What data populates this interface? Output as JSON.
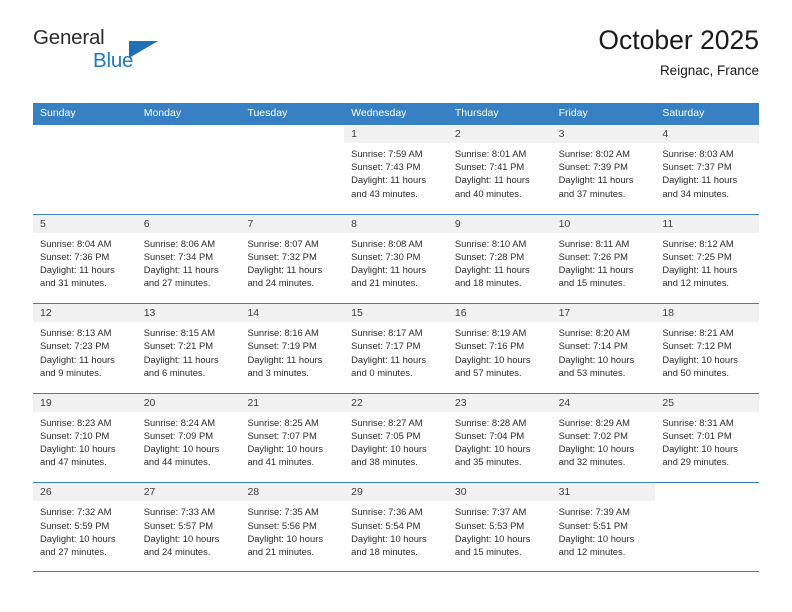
{
  "brand": {
    "name_top": "General",
    "name_bottom": "Blue",
    "color_dark": "#2b2b2b",
    "color_blue": "#2077c4"
  },
  "header": {
    "title": "October 2025",
    "subtitle": "Reignac, France"
  },
  "theme": {
    "header_blue": "#3880c4",
    "daynum_band": "#f1f1f1",
    "text": "#2b2b2b"
  },
  "weekday_headers": [
    "Sunday",
    "Monday",
    "Tuesday",
    "Wednesday",
    "Thursday",
    "Friday",
    "Saturday"
  ],
  "weeks": [
    [
      {
        "day": "",
        "blank": true,
        "lines": []
      },
      {
        "day": "",
        "blank": true,
        "lines": []
      },
      {
        "day": "",
        "blank": true,
        "lines": []
      },
      {
        "day": "1",
        "lines": [
          "Sunrise: 7:59 AM",
          "Sunset: 7:43 PM",
          "Daylight: 11 hours",
          "and 43 minutes."
        ]
      },
      {
        "day": "2",
        "lines": [
          "Sunrise: 8:01 AM",
          "Sunset: 7:41 PM",
          "Daylight: 11 hours",
          "and 40 minutes."
        ]
      },
      {
        "day": "3",
        "lines": [
          "Sunrise: 8:02 AM",
          "Sunset: 7:39 PM",
          "Daylight: 11 hours",
          "and 37 minutes."
        ]
      },
      {
        "day": "4",
        "lines": [
          "Sunrise: 8:03 AM",
          "Sunset: 7:37 PM",
          "Daylight: 11 hours",
          "and 34 minutes."
        ]
      }
    ],
    [
      {
        "day": "5",
        "lines": [
          "Sunrise: 8:04 AM",
          "Sunset: 7:36 PM",
          "Daylight: 11 hours",
          "and 31 minutes."
        ]
      },
      {
        "day": "6",
        "lines": [
          "Sunrise: 8:06 AM",
          "Sunset: 7:34 PM",
          "Daylight: 11 hours",
          "and 27 minutes."
        ]
      },
      {
        "day": "7",
        "lines": [
          "Sunrise: 8:07 AM",
          "Sunset: 7:32 PM",
          "Daylight: 11 hours",
          "and 24 minutes."
        ]
      },
      {
        "day": "8",
        "lines": [
          "Sunrise: 8:08 AM",
          "Sunset: 7:30 PM",
          "Daylight: 11 hours",
          "and 21 minutes."
        ]
      },
      {
        "day": "9",
        "lines": [
          "Sunrise: 8:10 AM",
          "Sunset: 7:28 PM",
          "Daylight: 11 hours",
          "and 18 minutes."
        ]
      },
      {
        "day": "10",
        "lines": [
          "Sunrise: 8:11 AM",
          "Sunset: 7:26 PM",
          "Daylight: 11 hours",
          "and 15 minutes."
        ]
      },
      {
        "day": "11",
        "lines": [
          "Sunrise: 8:12 AM",
          "Sunset: 7:25 PM",
          "Daylight: 11 hours",
          "and 12 minutes."
        ]
      }
    ],
    [
      {
        "day": "12",
        "lines": [
          "Sunrise: 8:13 AM",
          "Sunset: 7:23 PM",
          "Daylight: 11 hours",
          "and 9 minutes."
        ]
      },
      {
        "day": "13",
        "lines": [
          "Sunrise: 8:15 AM",
          "Sunset: 7:21 PM",
          "Daylight: 11 hours",
          "and 6 minutes."
        ]
      },
      {
        "day": "14",
        "lines": [
          "Sunrise: 8:16 AM",
          "Sunset: 7:19 PM",
          "Daylight: 11 hours",
          "and 3 minutes."
        ]
      },
      {
        "day": "15",
        "lines": [
          "Sunrise: 8:17 AM",
          "Sunset: 7:17 PM",
          "Daylight: 11 hours",
          "and 0 minutes."
        ]
      },
      {
        "day": "16",
        "lines": [
          "Sunrise: 8:19 AM",
          "Sunset: 7:16 PM",
          "Daylight: 10 hours",
          "and 57 minutes."
        ]
      },
      {
        "day": "17",
        "lines": [
          "Sunrise: 8:20 AM",
          "Sunset: 7:14 PM",
          "Daylight: 10 hours",
          "and 53 minutes."
        ]
      },
      {
        "day": "18",
        "lines": [
          "Sunrise: 8:21 AM",
          "Sunset: 7:12 PM",
          "Daylight: 10 hours",
          "and 50 minutes."
        ]
      }
    ],
    [
      {
        "day": "19",
        "lines": [
          "Sunrise: 8:23 AM",
          "Sunset: 7:10 PM",
          "Daylight: 10 hours",
          "and 47 minutes."
        ]
      },
      {
        "day": "20",
        "lines": [
          "Sunrise: 8:24 AM",
          "Sunset: 7:09 PM",
          "Daylight: 10 hours",
          "and 44 minutes."
        ]
      },
      {
        "day": "21",
        "lines": [
          "Sunrise: 8:25 AM",
          "Sunset: 7:07 PM",
          "Daylight: 10 hours",
          "and 41 minutes."
        ]
      },
      {
        "day": "22",
        "lines": [
          "Sunrise: 8:27 AM",
          "Sunset: 7:05 PM",
          "Daylight: 10 hours",
          "and 38 minutes."
        ]
      },
      {
        "day": "23",
        "lines": [
          "Sunrise: 8:28 AM",
          "Sunset: 7:04 PM",
          "Daylight: 10 hours",
          "and 35 minutes."
        ]
      },
      {
        "day": "24",
        "lines": [
          "Sunrise: 8:29 AM",
          "Sunset: 7:02 PM",
          "Daylight: 10 hours",
          "and 32 minutes."
        ]
      },
      {
        "day": "25",
        "lines": [
          "Sunrise: 8:31 AM",
          "Sunset: 7:01 PM",
          "Daylight: 10 hours",
          "and 29 minutes."
        ]
      }
    ],
    [
      {
        "day": "26",
        "lines": [
          "Sunrise: 7:32 AM",
          "Sunset: 5:59 PM",
          "Daylight: 10 hours",
          "and 27 minutes."
        ]
      },
      {
        "day": "27",
        "lines": [
          "Sunrise: 7:33 AM",
          "Sunset: 5:57 PM",
          "Daylight: 10 hours",
          "and 24 minutes."
        ]
      },
      {
        "day": "28",
        "lines": [
          "Sunrise: 7:35 AM",
          "Sunset: 5:56 PM",
          "Daylight: 10 hours",
          "and 21 minutes."
        ]
      },
      {
        "day": "29",
        "lines": [
          "Sunrise: 7:36 AM",
          "Sunset: 5:54 PM",
          "Daylight: 10 hours",
          "and 18 minutes."
        ]
      },
      {
        "day": "30",
        "lines": [
          "Sunrise: 7:37 AM",
          "Sunset: 5:53 PM",
          "Daylight: 10 hours",
          "and 15 minutes."
        ]
      },
      {
        "day": "31",
        "lines": [
          "Sunrise: 7:39 AM",
          "Sunset: 5:51 PM",
          "Daylight: 10 hours",
          "and 12 minutes."
        ]
      },
      {
        "day": "",
        "blank": true,
        "lines": []
      }
    ]
  ]
}
